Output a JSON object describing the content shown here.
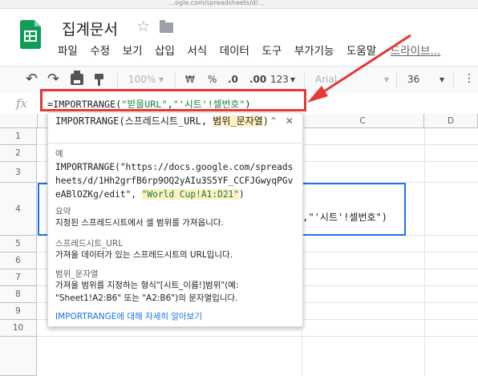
{
  "browser": {
    "url_fragment": "…ogle.com/spreadsheets/d/…"
  },
  "app": {
    "doc_title": "집계문서"
  },
  "menu": [
    "파일",
    "수정",
    "보기",
    "삽입",
    "서식",
    "데이터",
    "도구",
    "부가기능",
    "도움말"
  ],
  "menu_drive": "드라이브...",
  "toolbar": {
    "zoom": "100%",
    "currency": "₩",
    "percent": "%",
    "decimal_decrease": ".0",
    "decimal_increase": ".00",
    "number_format": "123",
    "font": "Arial",
    "font_size": "36",
    "more": "⋮"
  },
  "formula_bar": {
    "fx": "fx",
    "formula_prefix": "=IMPORTRANGE(",
    "arg1": "\"받을URL\"",
    "comma": ",",
    "arg2": "\"'시트'!셀번호\"",
    "close": ")"
  },
  "grid": {
    "columns": [
      "C",
      "D"
    ],
    "rows": [
      "1",
      "2",
      "3",
      "4",
      "5",
      "6",
      "7",
      "8",
      "9",
      "10"
    ],
    "cell_tail": "\",\"'시트'!셀번호\")"
  },
  "help_popup": {
    "signature_prefix": "IMPORTRANGE(스프레드시트_URL, ",
    "signature_param": "범위_문자열",
    "signature_suffix": ")",
    "example_label": "예",
    "example_main": "IMPORTRANGE(\"https://docs.google.com/spreadsheets/d/1Hh2grfB6rp9OQ2yAIu3S5YF_CCFJGwyqPGveABlOZKg/edit\", ",
    "example_highlight": "\"World Cup!A1:D21\"",
    "example_close": ")",
    "summary_label": "요약",
    "summary_text": "지정된 스프레드시트에서 셀 범위를 가져옵니다.",
    "param1_label": "스프레드시트_URL",
    "param1_text": "가져올 데이터가 있는 스프레드시트의 URL입니다.",
    "param2_label": "범위_문자열",
    "param2_text": "가져올 범위를 지정하는 형식\"[시트_이름!]범위\"(예: \"Sheet1!A2:B6\" 또는 \"A2:B6\")의 문자열입니다.",
    "learn_more": "IMPORTRANGE에 대해 자세히 알아보기"
  },
  "colors": {
    "brand_green": "#0f9d58",
    "string_green": "#188038",
    "annotation_red": "#e53935",
    "selection_blue": "#1a73e8",
    "param_highlight": "#fef0c3"
  }
}
